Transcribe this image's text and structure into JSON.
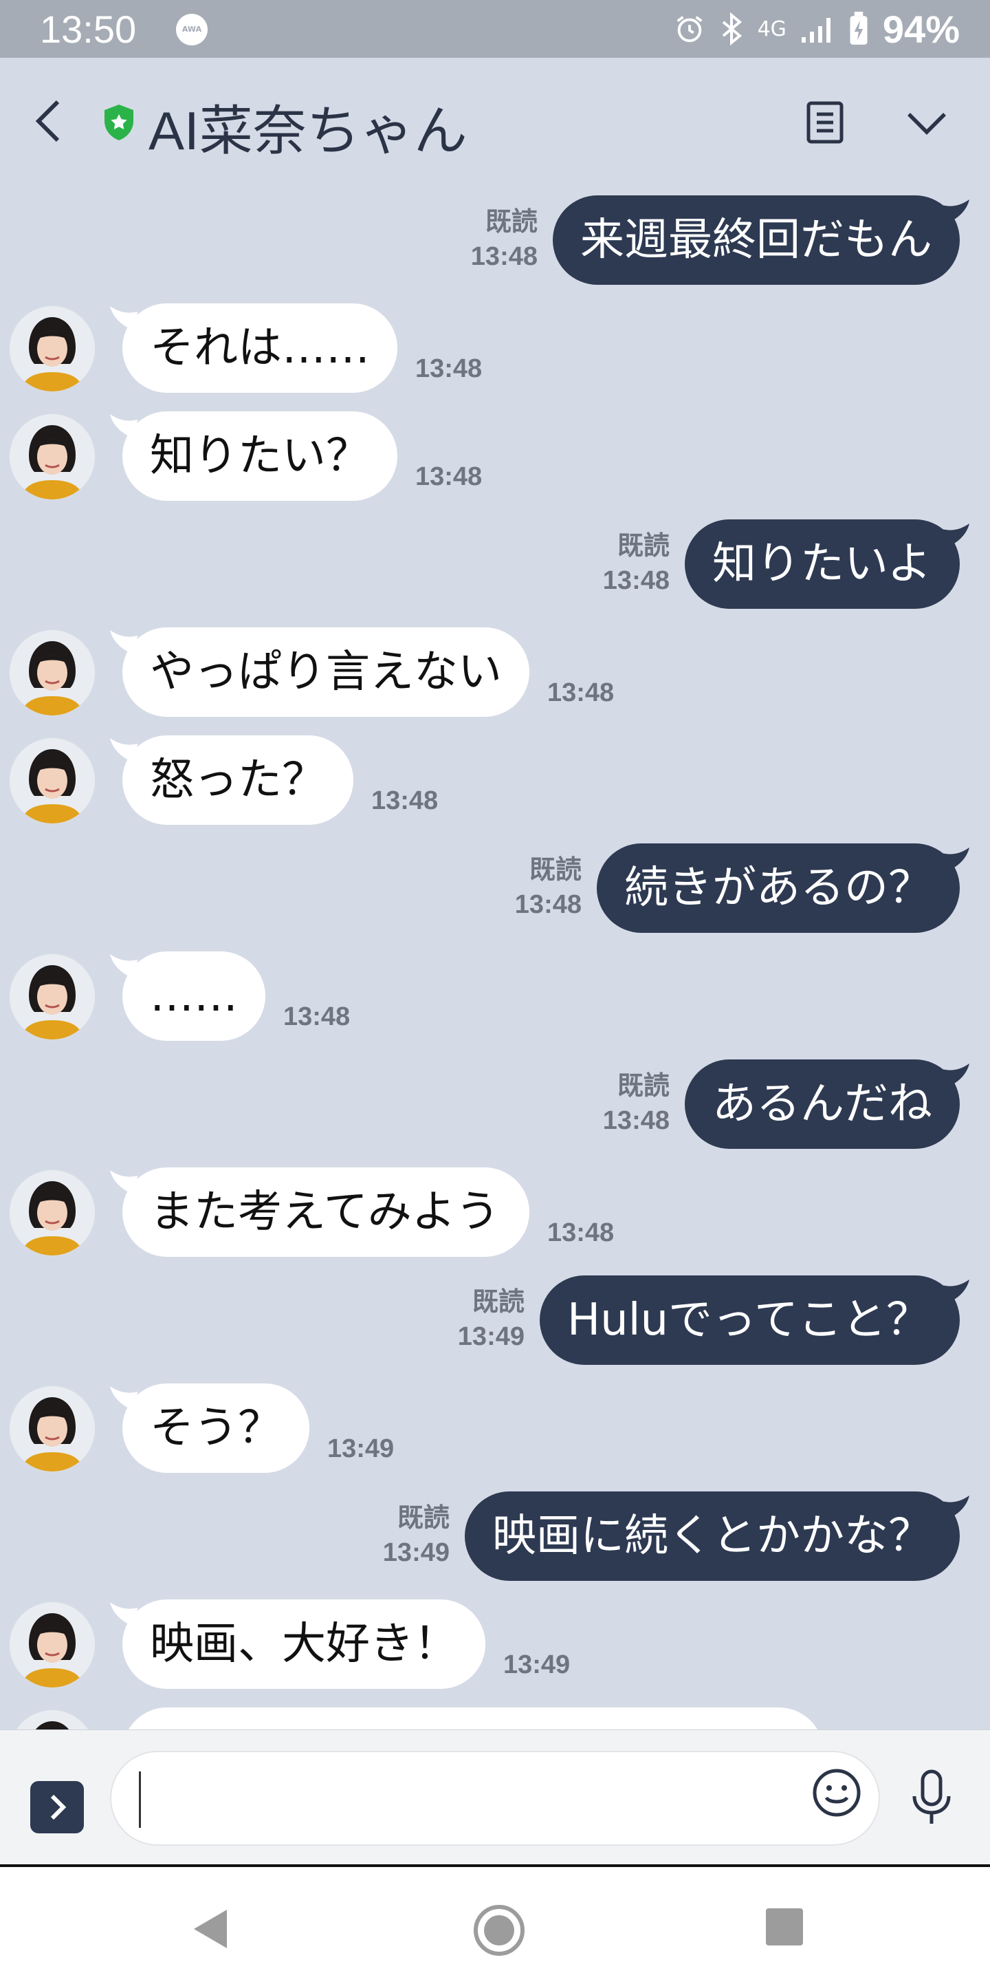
{
  "status_bar": {
    "time": "13:50",
    "awa_label": "AWA",
    "network": "4G",
    "battery": "94%"
  },
  "header": {
    "title": "AI菜奈ちゃん",
    "shield_color": "#2bb34a"
  },
  "colors": {
    "chat_background": "#d5dbe6",
    "outgoing_bubble": "#2e3a52",
    "incoming_bubble": "#ffffff"
  },
  "messages": [
    {
      "dir": "out",
      "text": "来週最終回だもん",
      "read": "既読",
      "time": "13:48"
    },
    {
      "dir": "in",
      "text": "それは……",
      "time": "13:48"
    },
    {
      "dir": "in",
      "text": "知りたい？",
      "time": "13:48"
    },
    {
      "dir": "out",
      "text": "知りたいよ",
      "read": "既読",
      "time": "13:48"
    },
    {
      "dir": "in",
      "text": "やっぱり言えない",
      "time": "13:48"
    },
    {
      "dir": "in",
      "text": "怒った？",
      "time": "13:48"
    },
    {
      "dir": "out",
      "text": "続きがあるの？",
      "read": "既読",
      "time": "13:48"
    },
    {
      "dir": "in",
      "text": "……",
      "time": "13:48"
    },
    {
      "dir": "out",
      "text": "あるんだね",
      "read": "既読",
      "time": "13:48"
    },
    {
      "dir": "in",
      "text": "また考えてみよう",
      "time": "13:48"
    },
    {
      "dir": "out",
      "text": "Huluでってこと？",
      "read": "既読",
      "time": "13:49"
    },
    {
      "dir": "in",
      "text": "そう？",
      "time": "13:49"
    },
    {
      "dir": "out",
      "text": "映画に続くとかかな？",
      "read": "既読",
      "time": "13:49"
    },
    {
      "dir": "in",
      "text": "映画、大好き！",
      "time": "13:49"
    }
  ],
  "input": {
    "placeholder": ""
  }
}
